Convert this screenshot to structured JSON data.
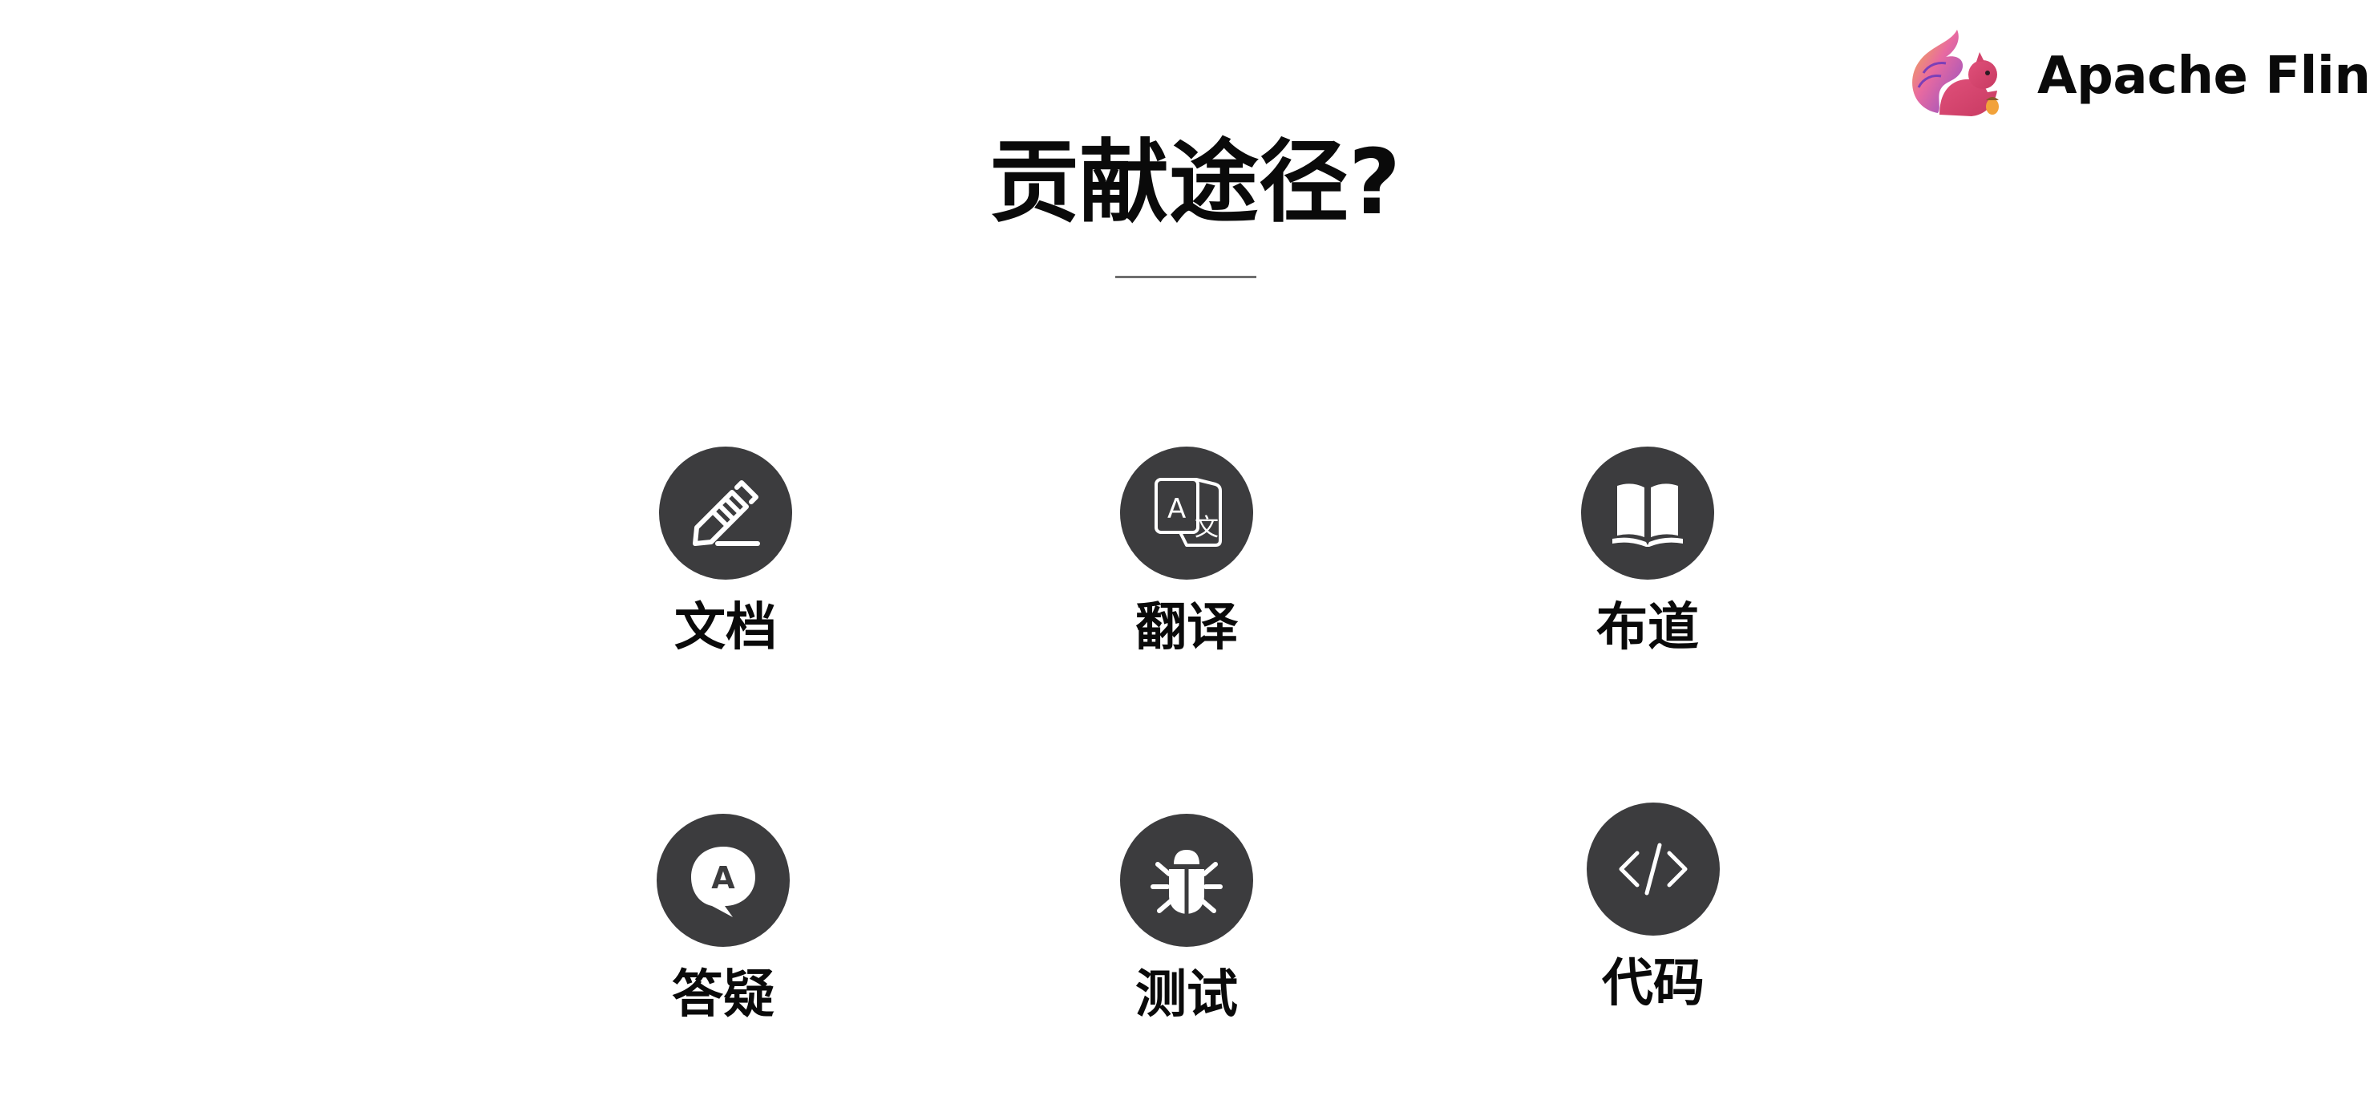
{
  "brand": {
    "name": "Apache Flink",
    "logo_icon": "flink-squirrel-logo"
  },
  "slide": {
    "title": "贡献途径?"
  },
  "ways": [
    {
      "label": "文档",
      "icon": "pencil-icon"
    },
    {
      "label": "翻译",
      "icon": "translate-icon"
    },
    {
      "label": "布道",
      "icon": "open-book-icon"
    },
    {
      "label": "答疑",
      "icon": "answer-bubble-icon"
    },
    {
      "label": "测试",
      "icon": "bug-icon"
    },
    {
      "label": "代码",
      "icon": "code-icon"
    }
  ],
  "colors": {
    "icon_circle": "#3c3c3e",
    "icon_glyph": "#ffffff",
    "text": "#0a0a0a",
    "rule": "#6f6f6f"
  }
}
